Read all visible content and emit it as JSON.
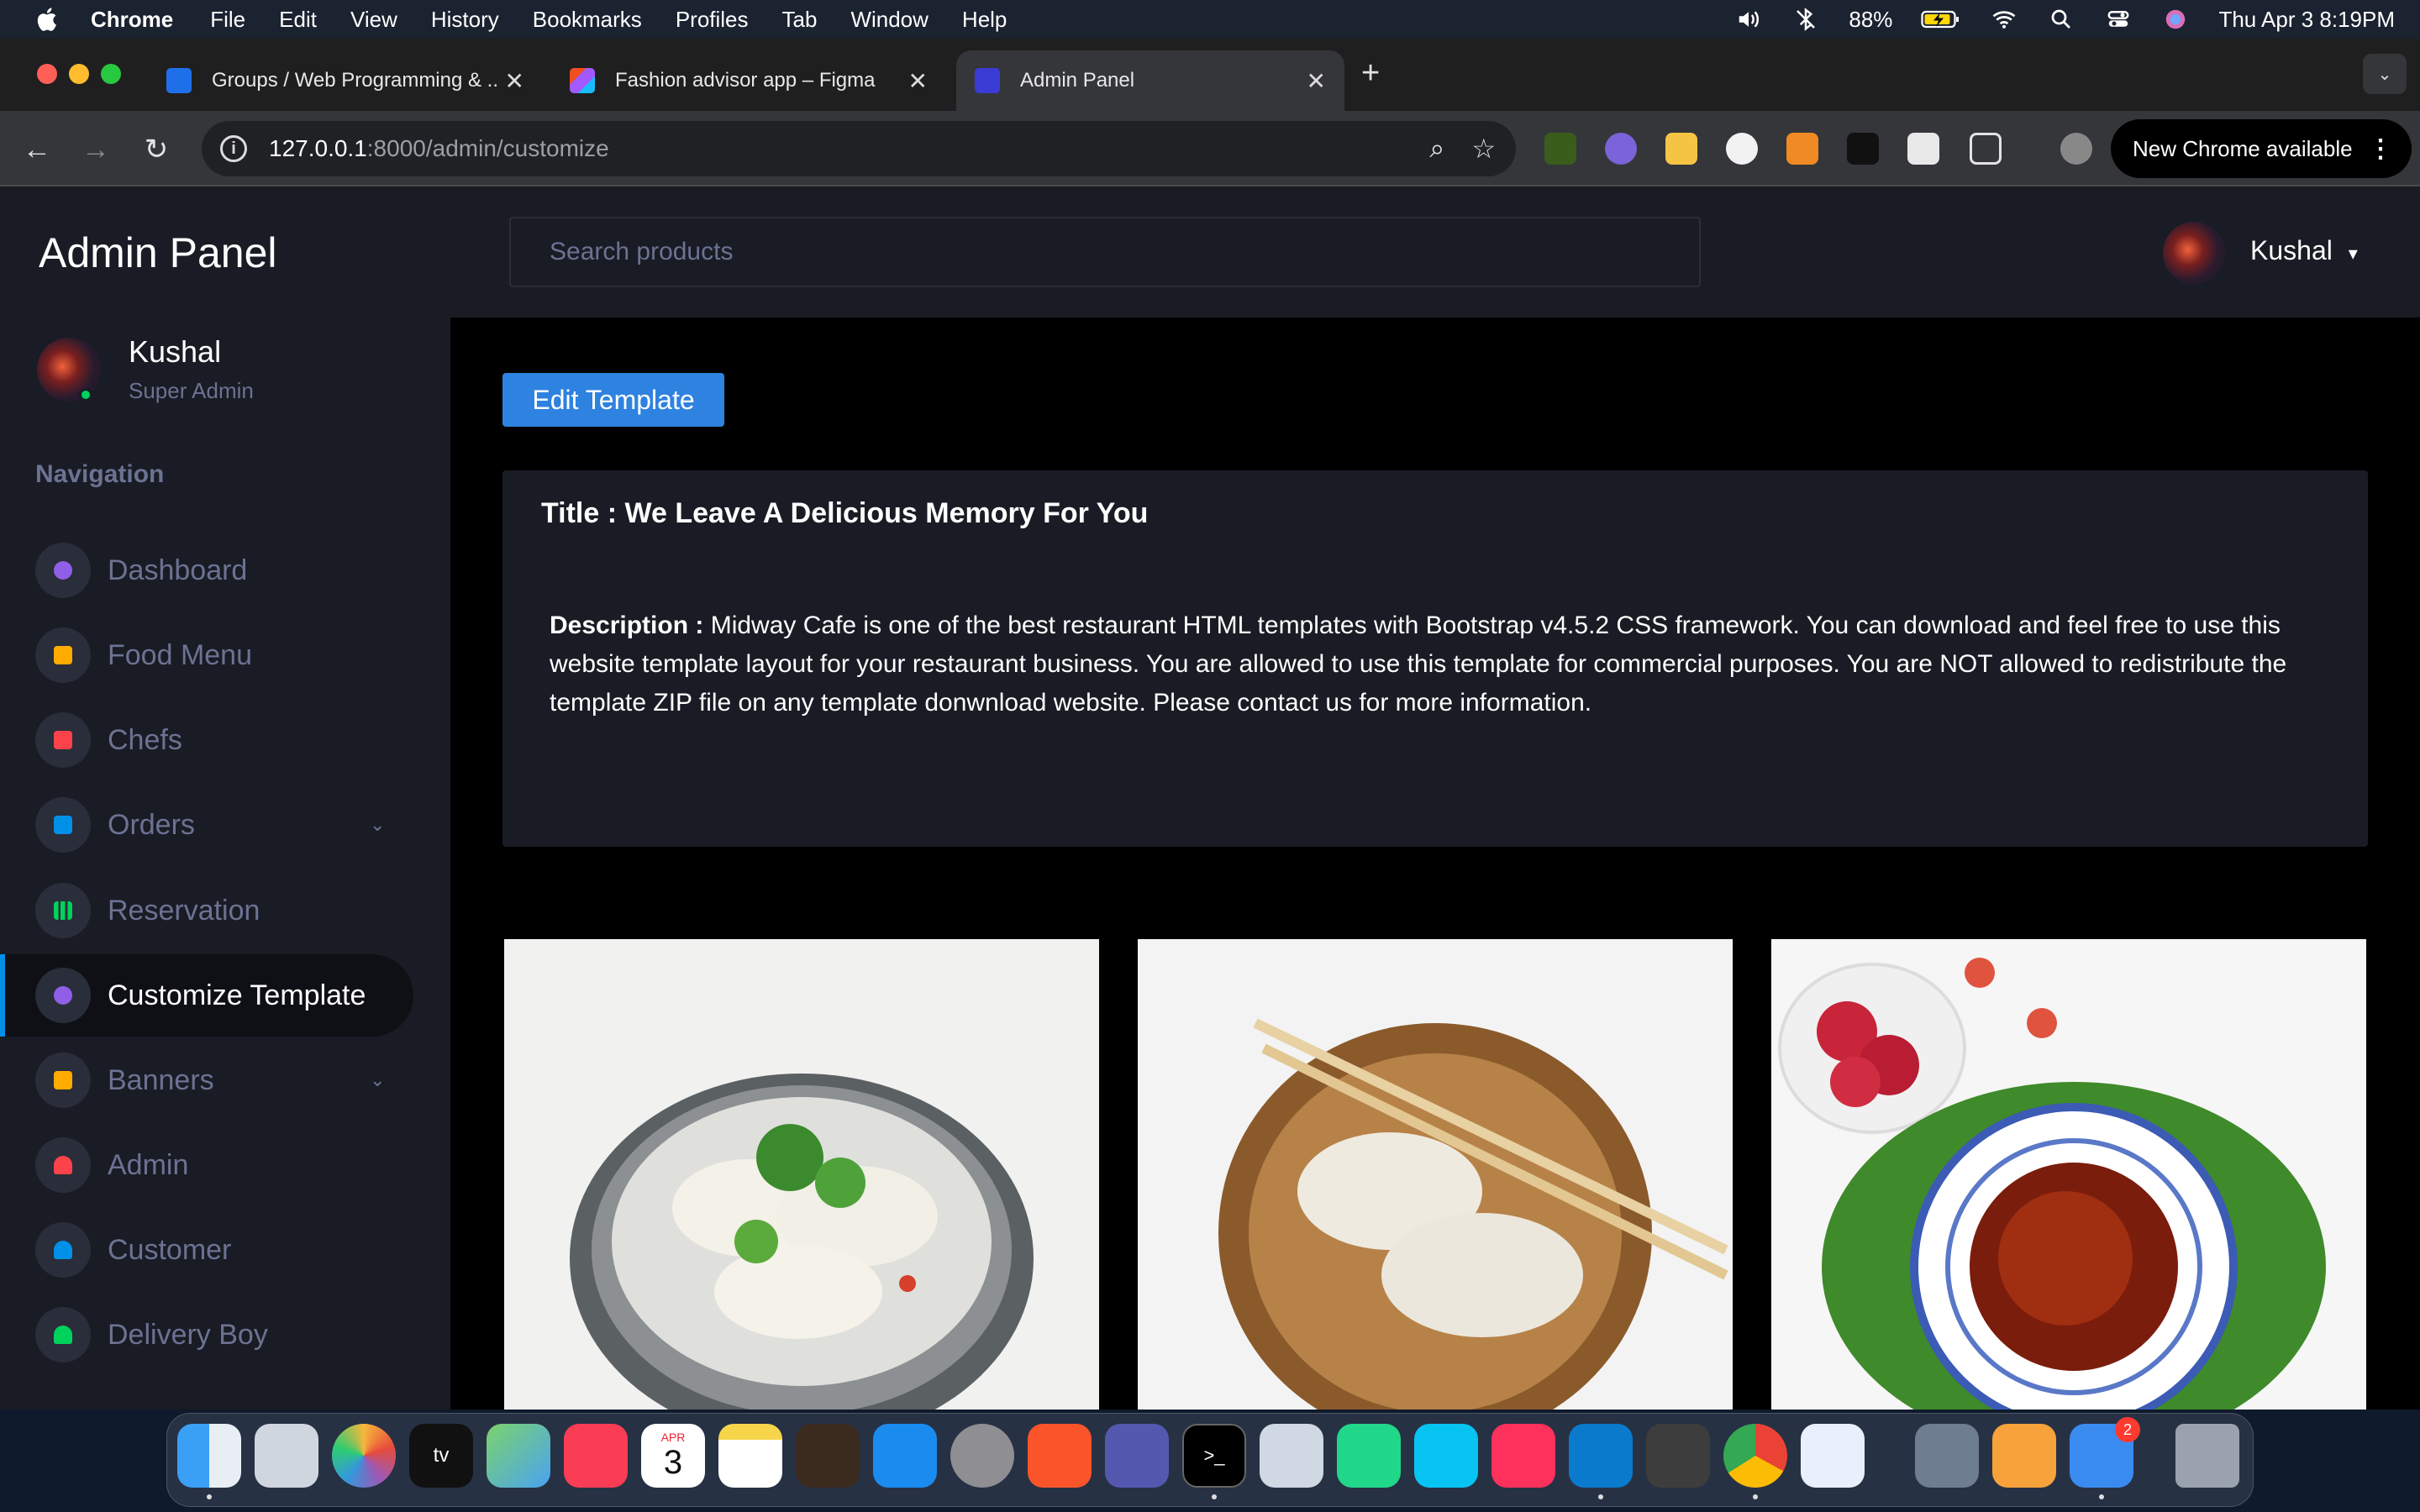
{
  "menubar": {
    "app_name": "Chrome",
    "items": [
      "File",
      "Edit",
      "View",
      "History",
      "Bookmarks",
      "Profiles",
      "Tab",
      "Window",
      "Help"
    ],
    "battery": "88%",
    "datetime": "Thu Apr 3  8:19PM"
  },
  "browser": {
    "tabs": [
      {
        "title": "Groups / Web Programming & ...",
        "favicon_color": "#1f6feb"
      },
      {
        "title": "Fashion advisor app – Figma",
        "favicon_color": "#f24e1e"
      },
      {
        "title": "Admin Panel",
        "favicon_color": "#3b3bd6"
      }
    ],
    "new_tab": "+",
    "url_host": "127.0.0.1",
    "url_path": ":8000/admin/customize",
    "new_chrome_label": "New Chrome available"
  },
  "sidebar": {
    "brand": "Admin Panel",
    "profile_name": "Kushal",
    "profile_role": "Super Admin",
    "nav_title": "Navigation",
    "items": [
      {
        "label": "Dashboard",
        "icon": "speedometer-icon",
        "color": "#8f5fe8"
      },
      {
        "label": "Food Menu",
        "icon": "food-icon",
        "color": "#ffab00"
      },
      {
        "label": "Chefs",
        "icon": "chef-icon",
        "color": "#fc424a"
      },
      {
        "label": "Orders",
        "icon": "orders-icon",
        "color": "#0090e7"
      },
      {
        "label": "Reservation",
        "icon": "chart-icon",
        "color": "#00d25b"
      },
      {
        "label": "Customize Template",
        "icon": "gear-icon",
        "color": "#8f5fe8"
      },
      {
        "label": "Banners",
        "icon": "banner-icon",
        "color": "#ffab00"
      },
      {
        "label": "Admin",
        "icon": "users-icon",
        "color": "#fc424a"
      },
      {
        "label": "Customer",
        "icon": "user-icon",
        "color": "#0090e7"
      },
      {
        "label": "Delivery Boy",
        "icon": "user-plus-icon",
        "color": "#00d25b"
      }
    ]
  },
  "topbar": {
    "search_placeholder": "Search products",
    "user_name": "Kushal"
  },
  "main": {
    "edit_button": "Edit Template",
    "title_line": "Title : We Leave A Delicious Memory For You",
    "description_label": "Description :",
    "description_text": "Midway Cafe is one of the best restaurant HTML templates with Bootstrap v4.5.2 CSS framework. You can download and feel free to use this website template layout for your restaurant business. You are allowed to use this template for commercial purposes. You are NOT allowed to redistribute the template ZIP file on any template donwnload website. Please contact us for more information."
  },
  "dock": {
    "calendar_month": "APR",
    "calendar_day": "3",
    "mail_badge": "2"
  }
}
